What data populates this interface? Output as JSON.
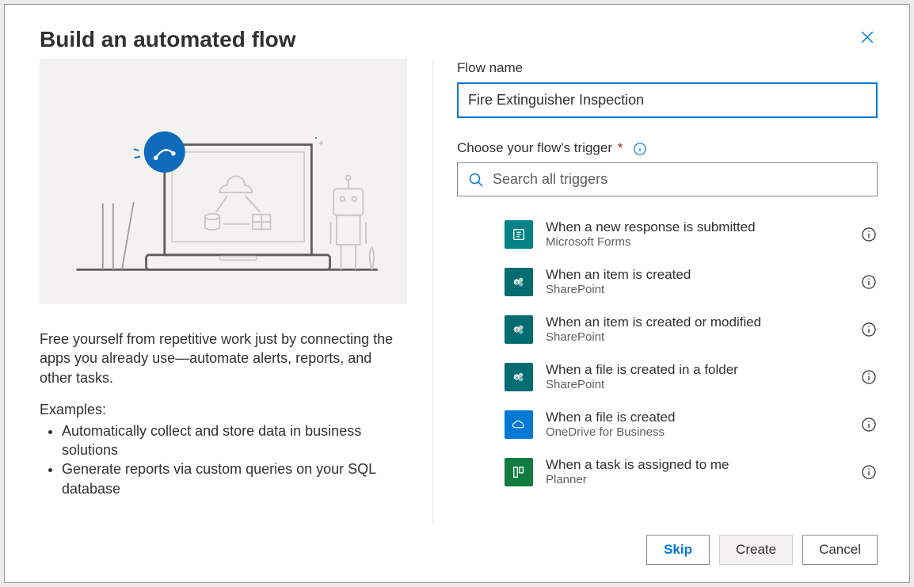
{
  "header": {
    "title": "Build an automated flow"
  },
  "left": {
    "description": "Free yourself from repetitive work just by connecting the apps you already use—automate alerts, reports, and other tasks.",
    "examples_label": "Examples:",
    "examples": [
      "Automatically collect and store data in business solutions",
      "Generate reports via custom queries on your SQL database"
    ]
  },
  "right": {
    "flow_name_label": "Flow name",
    "flow_name_value": "Fire Extinguisher Inspection",
    "trigger_label": "Choose your flow's trigger",
    "search_placeholder": "Search all triggers",
    "search_value": "",
    "triggers": [
      {
        "title": "When a new response is submitted",
        "sub": "Microsoft Forms",
        "color": "#038387",
        "icon": "forms"
      },
      {
        "title": "When an item is created",
        "sub": "SharePoint",
        "color": "#036c70",
        "icon": "sharepoint"
      },
      {
        "title": "When an item is created or modified",
        "sub": "SharePoint",
        "color": "#036c70",
        "icon": "sharepoint"
      },
      {
        "title": "When a file is created in a folder",
        "sub": "SharePoint",
        "color": "#036c70",
        "icon": "sharepoint"
      },
      {
        "title": "When a file is created",
        "sub": "OneDrive for Business",
        "color": "#0078d4",
        "icon": "onedrive"
      },
      {
        "title": "When a task is assigned to me",
        "sub": "Planner",
        "color": "#107c41",
        "icon": "planner"
      }
    ]
  },
  "footer": {
    "skip": "Skip",
    "create": "Create",
    "cancel": "Cancel"
  }
}
